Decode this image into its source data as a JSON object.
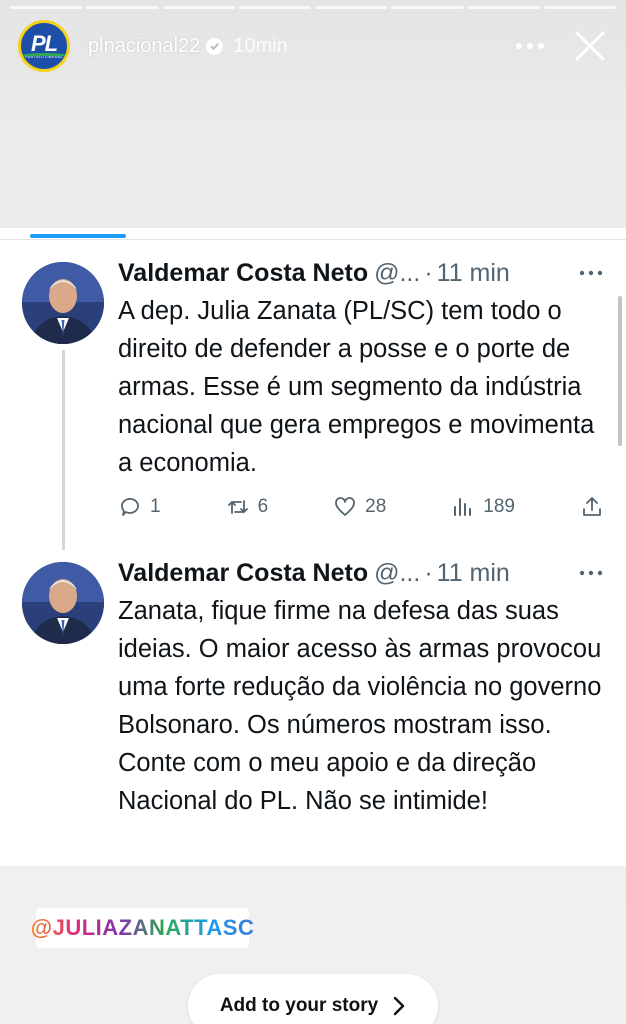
{
  "story": {
    "account_name": "plnacional22",
    "time_ago": "10min",
    "logo_text": "PL",
    "logo_subtext": "PARTIDO LIBERAL",
    "progress_segments": 8,
    "active_segment": 2
  },
  "tweets": [
    {
      "name": "Valdemar Costa Neto",
      "handle": "@...",
      "separator": "·",
      "time": "11 min",
      "text": "A dep. Julia Zanata (PL/SC) tem todo o direito de defender a posse e o porte de armas. Esse é um segmento da indústria nacional que gera empregos e movimenta a economia.",
      "replies": "1",
      "retweets": "6",
      "likes": "28",
      "views": "189"
    },
    {
      "name": "Valdemar Costa Neto",
      "handle": "@...",
      "separator": "·",
      "time": "11 min",
      "text": "Zanata, fique firme na defesa das suas ideias. O maior acesso às armas provocou uma forte redução da violência no governo Bolsonaro. Os números mostram isso. Conte com o meu apoio e da direção Nacional do PL. Não se intimide!"
    }
  ],
  "mention": "@JULIAZANATTASC",
  "add_to_story": "Add to your story",
  "colors": {
    "accent": "#1d9bf0",
    "muted_text": "#536471",
    "logo_blue": "#1d4fa8",
    "logo_yellow": "#f5d21a"
  }
}
